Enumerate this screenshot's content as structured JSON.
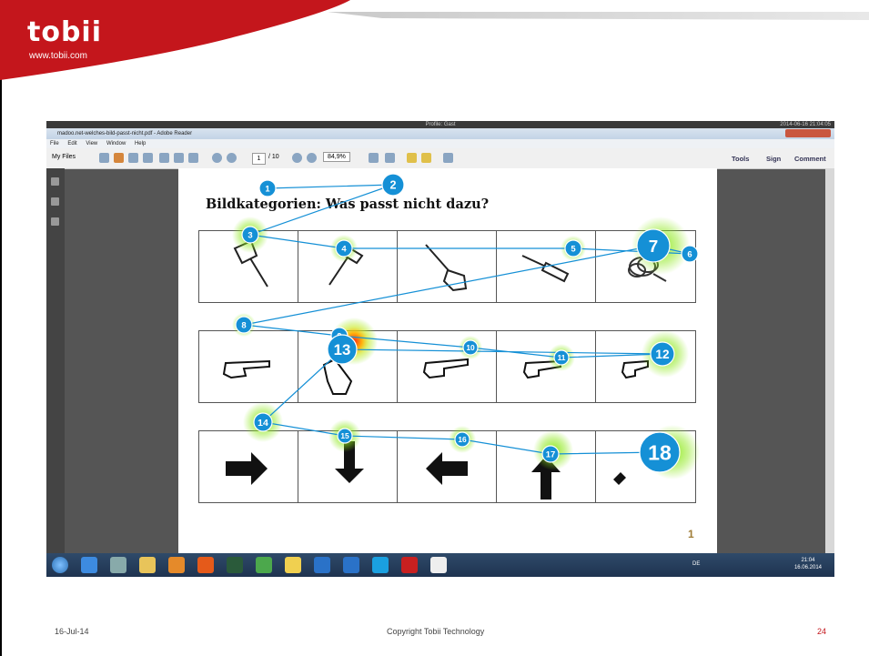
{
  "slide": {
    "logo": "tobii",
    "logo_url": "www.tobii.com",
    "footer_date": "16-Jul-14",
    "footer_copyright": "Copyright Tobii Technology",
    "slide_number": "24"
  },
  "screenshot": {
    "profile_label": "Profile: Gast",
    "timestamp": "2014-06-16 21:04:05",
    "window_title": "madoo.net-welches-bild-passt-nicht.pdf - Adobe Reader",
    "menu": [
      "File",
      "Edit",
      "View",
      "Window",
      "Help"
    ],
    "toolbar": {
      "my_files": "My Files",
      "page_current": "1",
      "page_total": "/ 10",
      "zoom": "84,9%",
      "tools": "Tools",
      "sign": "Sign",
      "comment": "Comment"
    },
    "document": {
      "heading": "Bildkategorien: Was passt nicht dazu?",
      "page_number": "1"
    },
    "taskbar": {
      "lang": "DE",
      "time": "21:04",
      "date": "16.06.2014"
    }
  },
  "fixations": [
    {
      "label": "1"
    },
    {
      "label": "2"
    },
    {
      "label": "3"
    },
    {
      "label": "4"
    },
    {
      "label": "5"
    },
    {
      "label": "6"
    },
    {
      "label": "7"
    },
    {
      "label": "8"
    },
    {
      "label": "9"
    },
    {
      "label": "10"
    },
    {
      "label": "11"
    },
    {
      "label": "12"
    },
    {
      "label": "13"
    },
    {
      "label": "14"
    },
    {
      "label": "15"
    },
    {
      "label": "16"
    },
    {
      "label": "17"
    },
    {
      "label": "18"
    }
  ],
  "colors": {
    "banner_red": "#c4161c",
    "fixation_blue": "#1590d6",
    "heat_green": "#7fd21c",
    "heat_hot": "#ff3b1a"
  }
}
